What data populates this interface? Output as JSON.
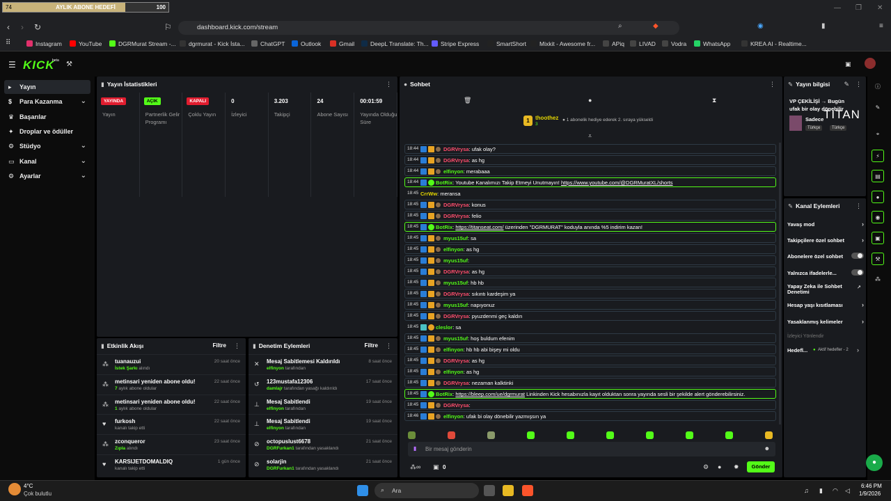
{
  "goal_bar": {
    "left": "74",
    "title": "AYLIK ABONE HEDEFİ",
    "right": "100",
    "progress": 0.74
  },
  "browser": {
    "url": "dashboard.kick.com/stream"
  },
  "bookmarks": [
    {
      "label": "Instagram",
      "color": "#e1306c"
    },
    {
      "label": "YouTube",
      "color": "#ff0000"
    },
    {
      "label": "DGRMurat Stream -...",
      "color": "#53fc18"
    },
    {
      "label": "dgrmurat - Kick İsta...",
      "color": "#333"
    },
    {
      "label": "ChatGPT",
      "color": "#666"
    },
    {
      "label": "Outlook",
      "color": "#0a64d8"
    },
    {
      "label": "Gmail",
      "color": "#d93025"
    },
    {
      "label": "DeepL Translate: Th...",
      "color": "#0f2b46"
    },
    {
      "label": "Stripe Express",
      "color": "#635bff"
    },
    {
      "label": "SmartShort",
      "color": "#222"
    },
    {
      "label": "Mixkit - Awesome fr...",
      "color": "#222"
    },
    {
      "label": "APiq",
      "color": "#444"
    },
    {
      "label": "LIVAD",
      "color": "#444"
    },
    {
      "label": "Vodra",
      "color": "#444"
    },
    {
      "label": "WhatsApp",
      "color": "#25d366"
    },
    {
      "label": "KREA AI - Realtime...",
      "color": "#333"
    }
  ],
  "app": {
    "logo": "KICK",
    "logo_sup": "beta"
  },
  "sidebar": {
    "items": [
      {
        "label": "Yayın",
        "icon": "play-icon",
        "active": true
      },
      {
        "label": "Para Kazanma",
        "icon": "money-icon",
        "chevron": true
      },
      {
        "label": "Başarılar",
        "icon": "trophy-icon"
      },
      {
        "label": "Droplar ve ödüller",
        "icon": "gift-icon"
      },
      {
        "label": "Stüdyo",
        "icon": "studio-icon",
        "chevron": true
      },
      {
        "label": "Kanal",
        "icon": "channel-icon",
        "chevron": true
      },
      {
        "label": "Ayarlar",
        "icon": "gear-icon",
        "chevron": true
      }
    ]
  },
  "stats": {
    "title": "Yayın İstatistikleri",
    "cells": [
      {
        "badge": "YAYINDA",
        "badge_color": "#e11d2f",
        "label": "Yayın"
      },
      {
        "badge": "AÇIK",
        "badge_color": "#53fc18",
        "label": "Partnerlik Gelir Programı"
      },
      {
        "badge": "KAPALI",
        "badge_color": "#e11d2f",
        "label": "Çoklu Yayın"
      },
      {
        "value": "0",
        "label": "İzleyici"
      },
      {
        "value": "3.203",
        "label": "Takipçi"
      },
      {
        "value": "24",
        "label": "Abone Sayısı"
      },
      {
        "value": "00:01:59",
        "label": "Yayında Olduğu Süre"
      }
    ]
  },
  "activity": {
    "title": "Etkinlik Akışı",
    "filter": "Filtre",
    "rows": [
      {
        "title": "tuanauzui",
        "sub_hl": "İstek Şarkı",
        "sub": " alındı",
        "time": "20 saat önce",
        "icon": "dot-icon"
      },
      {
        "title": "metinsari yeniden abone oldu!",
        "sub_hl": "7",
        "sub": " aylık abone oldular",
        "time": "22 saat önce",
        "icon": "dot-icon"
      },
      {
        "title": "metinsari yeniden abone oldu!",
        "sub_hl": "1",
        "sub": " aylık abone oldular",
        "time": "22 saat önce",
        "icon": "dot-icon"
      },
      {
        "title": "furkosh",
        "sub_hl": "",
        "sub": "kanalı takip etti",
        "time": "22 saat önce",
        "icon": "heart-icon"
      },
      {
        "title": "zconqueror",
        "sub_hl": "Zıpla",
        "sub": " alındı",
        "time": "23 saat önce",
        "icon": "dot-icon"
      },
      {
        "title": "KARSIJETDOMALDIQ",
        "sub_hl": "",
        "sub": "kanalı takip etti",
        "time": "1 gün önce",
        "icon": "heart-icon"
      }
    ]
  },
  "moderation": {
    "title": "Denetim Eylemleri",
    "filter": "Filtre",
    "rows": [
      {
        "title": "Mesaj Sabitlemesi Kaldırıldı",
        "sub_hl": "elfinyon",
        "sub": " tarafından",
        "time": "8 saat önce",
        "icon": "unpin-icon"
      },
      {
        "title": "123mustafa12306",
        "sub_hl": "damlajr",
        "sub": " tarafından yasağı kaldırıldı",
        "time": "17 saat önce",
        "icon": "undo-icon"
      },
      {
        "title": "Mesaj Sabitlendi",
        "sub_hl": "elfinyon",
        "sub": " tarafından",
        "time": "19 saat önce",
        "icon": "pin-icon"
      },
      {
        "title": "Mesaj Sabitlendi",
        "sub_hl": "elfinyon",
        "sub": " tarafından",
        "time": "19 saat önce",
        "icon": "pin-icon"
      },
      {
        "title": "octopuslust6678",
        "sub_hl": "DGRFurkan1",
        "sub": " tarafından yasaklandı",
        "time": "21 saat önce",
        "icon": "ban-icon"
      },
      {
        "title": "solarjin",
        "sub_hl": "DGRFurkan1",
        "sub": " tarafından yasaklandı",
        "time": "21 saat önce",
        "icon": "ban-icon"
      }
    ]
  },
  "chat": {
    "title": "Sohbet",
    "gift_user": "thoothez",
    "gift_count": "1",
    "gift_sub": "3",
    "gift_text": "1 abonelik hediye ederek 2. sıraya yükseldi",
    "messages": [
      {
        "time": "18:44",
        "user": "DGRVrysa",
        "ucls": "u-red",
        "text": ": ufak olay?",
        "type": "mod"
      },
      {
        "time": "18:44",
        "user": "DGRVrysa",
        "ucls": "u-red",
        "text": ": as hg",
        "type": "mod"
      },
      {
        "time": "18:44",
        "user": "elfinyon",
        "ucls": "u-grn",
        "text": ": merabaaa",
        "type": "mod"
      },
      {
        "time": "18:44",
        "user": "BotRix",
        "ucls": "u-bot",
        "text": ": Youtube Kanalımızı Takip Etmeyi Unutmayın! ",
        "link": "https://www.youtube.com/@DGRMuratXL/shorts",
        "type": "bot"
      },
      {
        "time": "18:45",
        "user": "CrrWw",
        "ucls": "u-yel",
        "text": ": meransa",
        "type": "plain"
      },
      {
        "time": "18:45",
        "user": "DGRVrysa",
        "ucls": "u-red",
        "text": ": konus",
        "type": "mod"
      },
      {
        "time": "18:45",
        "user": "DGRVrysa",
        "ucls": "u-red",
        "text": ": felio",
        "type": "mod"
      },
      {
        "time": "18:45",
        "user": "BotRix",
        "ucls": "u-bot",
        "text": ": ",
        "link": "https://titanseat.com/",
        "after": " üzerinden \"DGRMURAT\" koduyla anında %5 indirim kazan!",
        "type": "bot"
      },
      {
        "time": "18:45",
        "user": "myus15uf",
        "ucls": "u-grn",
        "text": ": sa",
        "type": "mod"
      },
      {
        "time": "18:45",
        "user": "elfinyon",
        "ucls": "u-grn",
        "text": ": as hg",
        "type": "mod"
      },
      {
        "time": "18:45",
        "user": "myus15uf",
        "ucls": "u-grn",
        "text": ":",
        "type": "mod"
      },
      {
        "time": "18:45",
        "user": "DGRVrysa",
        "ucls": "u-red",
        "text": ": as hg",
        "type": "mod"
      },
      {
        "time": "18:45",
        "user": "myus15uf",
        "ucls": "u-grn",
        "text": ": hb hb",
        "type": "mod"
      },
      {
        "time": "18:45",
        "user": "DGRVrysa",
        "ucls": "u-red",
        "text": ": sıkıntı kardeşim ya",
        "type": "mod"
      },
      {
        "time": "18:45",
        "user": "myus15uf",
        "ucls": "u-grn",
        "text": ": napıyonuz",
        "type": "mod"
      },
      {
        "time": "18:45",
        "user": "DGRVrysa",
        "ucls": "u-red",
        "text": ": pyuzdenmi geç kaldın",
        "type": "mod"
      },
      {
        "time": "18:45",
        "user": "cleslor",
        "ucls": "u-grn",
        "text": ": sa",
        "type": "plain2"
      },
      {
        "time": "18:45",
        "user": "myus15uf",
        "ucls": "u-grn",
        "text": ": hoş buldum efenim",
        "type": "mod"
      },
      {
        "time": "18:45",
        "user": "elfinyon",
        "ucls": "u-grn",
        "text": ": hb hb abi bişey mi oldu",
        "type": "mod"
      },
      {
        "time": "18:45",
        "user": "DGRVrysa",
        "ucls": "u-red",
        "text": ": as hg",
        "type": "mod"
      },
      {
        "time": "18:45",
        "user": "elfinyon",
        "ucls": "u-grn",
        "text": ": as hg",
        "type": "mod"
      },
      {
        "time": "18:45",
        "user": "DGRVrysa",
        "ucls": "u-red",
        "text": ": nezaman kalktinki",
        "type": "mod"
      },
      {
        "time": "18:45",
        "user": "BotRix",
        "ucls": "u-bot",
        "text": ": ",
        "link": "https://bleep.com/ue/dgrmurat",
        "after": " Linkinden Kick hesabınızla kayıt olduktan sonra yayında sesli bir şekilde alert gönderebilirsiniz.",
        "type": "bot"
      },
      {
        "time": "18:45",
        "user": "DGRVrysa",
        "ucls": "u-red",
        "text": ":",
        "type": "mod"
      },
      {
        "time": "18:46",
        "user": "elfinyon",
        "ucls": "u-grn",
        "text": ": ufak bi olay dönebilir yazmışsın ya",
        "type": "mod"
      }
    ],
    "input_placeholder": "Bir mesaj gönderin",
    "send": "Gönder",
    "counter": "0"
  },
  "stream_info": {
    "title": "Yayın bilgisi",
    "text": "VP ÇEKİLİŞİ → Bugün ufak bir olay dönebilir tepinpay",
    "game": "Sadece",
    "tags": [
      "Türkçe",
      "Türkçe"
    ],
    "brand": "TITAN"
  },
  "channel_actions": {
    "title": "Kanal Eylemleri",
    "items": [
      {
        "label": "Yavaş mod",
        "kind": "arrow"
      },
      {
        "label": "Takipçilere özel sohbet",
        "kind": "arrow"
      },
      {
        "label": "Abonelere özel sohbet",
        "kind": "toggle"
      },
      {
        "label": "Yalnızca ifadelerle...",
        "kind": "toggle"
      },
      {
        "label": "Yapay Zeka ile Sohbet Denetimi",
        "kind": "ext"
      },
      {
        "label": "Hesap yaşı kısıtlaması",
        "kind": "arrow"
      },
      {
        "label": "Yasaklanmış kelimeler",
        "kind": "arrow"
      }
    ],
    "section": "İzleyici Yönlendir",
    "hedef_label": "Hedefl...",
    "hedef_sub": "Aktif hedefler - 2"
  },
  "taskbar": {
    "temp": "4°C",
    "weather": "Çok bulutlu",
    "search": "Ara",
    "time": "6:46 PM",
    "date": "1/9/2026"
  }
}
